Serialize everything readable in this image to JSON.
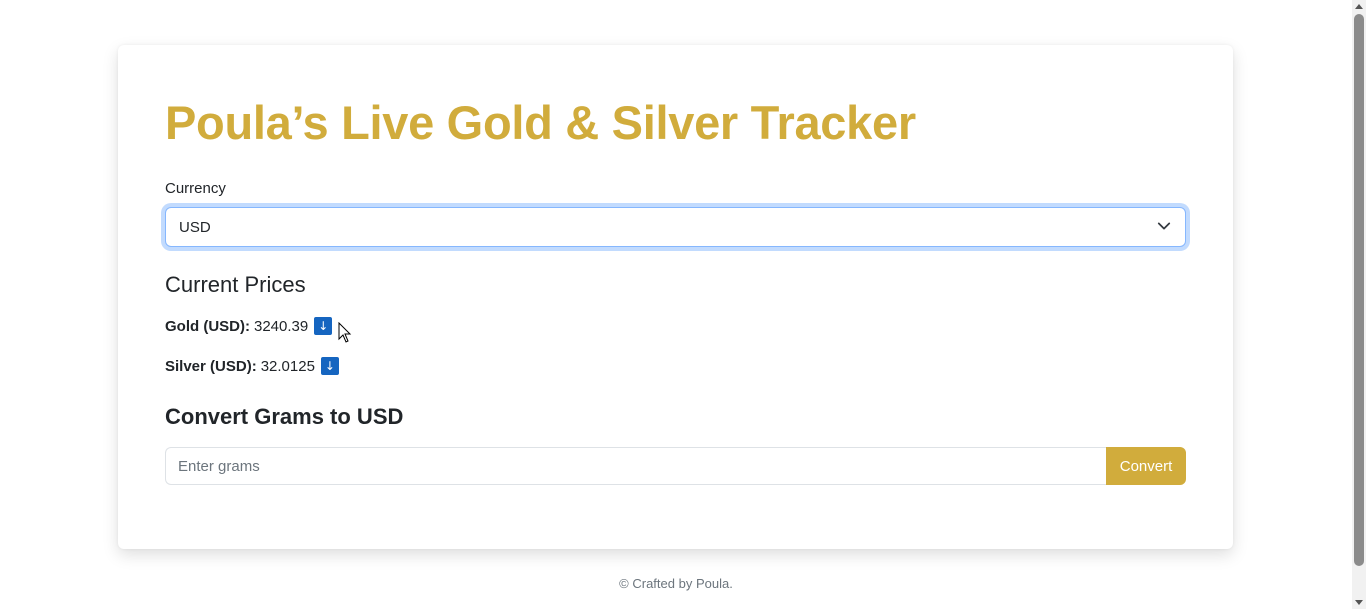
{
  "header": {
    "title": "Poula’s Live Gold & Silver Tracker"
  },
  "currency": {
    "label": "Currency",
    "selected": "USD"
  },
  "prices": {
    "heading": "Current Prices",
    "gold": {
      "label": "Gold (USD):",
      "value": "3240.39",
      "trend_icon": "down-arrow-icon",
      "trend_symbol": "↓"
    },
    "silver": {
      "label": "Silver (USD):",
      "value": "32.0125",
      "trend_icon": "down-arrow-icon",
      "trend_symbol": "↓"
    }
  },
  "converter": {
    "heading": "Convert Grams to USD",
    "placeholder": "Enter grams",
    "value": "",
    "button_label": "Convert"
  },
  "footer": {
    "text": "© Crafted by Poula."
  },
  "colors": {
    "accent": "#d1ac3c",
    "badge": "#1565c0",
    "focus": "#86b7fe"
  }
}
